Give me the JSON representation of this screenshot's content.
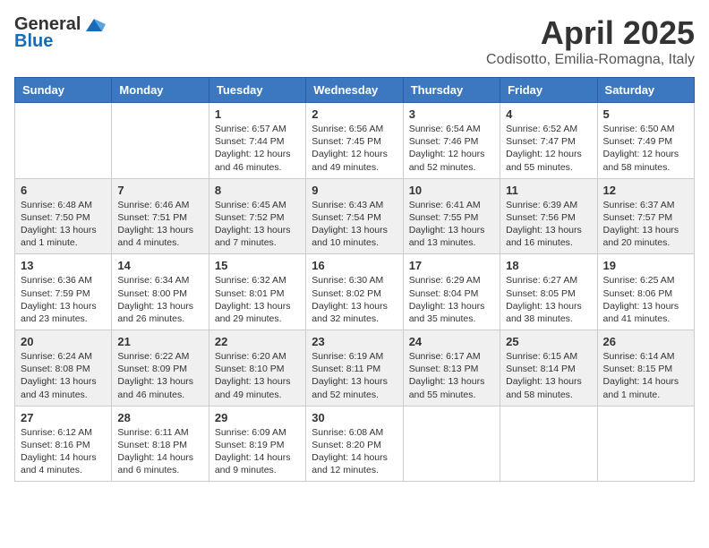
{
  "header": {
    "logo_general": "General",
    "logo_blue": "Blue",
    "month_title": "April 2025",
    "location": "Codisotto, Emilia-Romagna, Italy"
  },
  "weekdays": [
    "Sunday",
    "Monday",
    "Tuesday",
    "Wednesday",
    "Thursday",
    "Friday",
    "Saturday"
  ],
  "weeks": [
    [
      {
        "day": "",
        "info": ""
      },
      {
        "day": "",
        "info": ""
      },
      {
        "day": "1",
        "info": "Sunrise: 6:57 AM\nSunset: 7:44 PM\nDaylight: 12 hours\nand 46 minutes."
      },
      {
        "day": "2",
        "info": "Sunrise: 6:56 AM\nSunset: 7:45 PM\nDaylight: 12 hours\nand 49 minutes."
      },
      {
        "day": "3",
        "info": "Sunrise: 6:54 AM\nSunset: 7:46 PM\nDaylight: 12 hours\nand 52 minutes."
      },
      {
        "day": "4",
        "info": "Sunrise: 6:52 AM\nSunset: 7:47 PM\nDaylight: 12 hours\nand 55 minutes."
      },
      {
        "day": "5",
        "info": "Sunrise: 6:50 AM\nSunset: 7:49 PM\nDaylight: 12 hours\nand 58 minutes."
      }
    ],
    [
      {
        "day": "6",
        "info": "Sunrise: 6:48 AM\nSunset: 7:50 PM\nDaylight: 13 hours\nand 1 minute."
      },
      {
        "day": "7",
        "info": "Sunrise: 6:46 AM\nSunset: 7:51 PM\nDaylight: 13 hours\nand 4 minutes."
      },
      {
        "day": "8",
        "info": "Sunrise: 6:45 AM\nSunset: 7:52 PM\nDaylight: 13 hours\nand 7 minutes."
      },
      {
        "day": "9",
        "info": "Sunrise: 6:43 AM\nSunset: 7:54 PM\nDaylight: 13 hours\nand 10 minutes."
      },
      {
        "day": "10",
        "info": "Sunrise: 6:41 AM\nSunset: 7:55 PM\nDaylight: 13 hours\nand 13 minutes."
      },
      {
        "day": "11",
        "info": "Sunrise: 6:39 AM\nSunset: 7:56 PM\nDaylight: 13 hours\nand 16 minutes."
      },
      {
        "day": "12",
        "info": "Sunrise: 6:37 AM\nSunset: 7:57 PM\nDaylight: 13 hours\nand 20 minutes."
      }
    ],
    [
      {
        "day": "13",
        "info": "Sunrise: 6:36 AM\nSunset: 7:59 PM\nDaylight: 13 hours\nand 23 minutes."
      },
      {
        "day": "14",
        "info": "Sunrise: 6:34 AM\nSunset: 8:00 PM\nDaylight: 13 hours\nand 26 minutes."
      },
      {
        "day": "15",
        "info": "Sunrise: 6:32 AM\nSunset: 8:01 PM\nDaylight: 13 hours\nand 29 minutes."
      },
      {
        "day": "16",
        "info": "Sunrise: 6:30 AM\nSunset: 8:02 PM\nDaylight: 13 hours\nand 32 minutes."
      },
      {
        "day": "17",
        "info": "Sunrise: 6:29 AM\nSunset: 8:04 PM\nDaylight: 13 hours\nand 35 minutes."
      },
      {
        "day": "18",
        "info": "Sunrise: 6:27 AM\nSunset: 8:05 PM\nDaylight: 13 hours\nand 38 minutes."
      },
      {
        "day": "19",
        "info": "Sunrise: 6:25 AM\nSunset: 8:06 PM\nDaylight: 13 hours\nand 41 minutes."
      }
    ],
    [
      {
        "day": "20",
        "info": "Sunrise: 6:24 AM\nSunset: 8:08 PM\nDaylight: 13 hours\nand 43 minutes."
      },
      {
        "day": "21",
        "info": "Sunrise: 6:22 AM\nSunset: 8:09 PM\nDaylight: 13 hours\nand 46 minutes."
      },
      {
        "day": "22",
        "info": "Sunrise: 6:20 AM\nSunset: 8:10 PM\nDaylight: 13 hours\nand 49 minutes."
      },
      {
        "day": "23",
        "info": "Sunrise: 6:19 AM\nSunset: 8:11 PM\nDaylight: 13 hours\nand 52 minutes."
      },
      {
        "day": "24",
        "info": "Sunrise: 6:17 AM\nSunset: 8:13 PM\nDaylight: 13 hours\nand 55 minutes."
      },
      {
        "day": "25",
        "info": "Sunrise: 6:15 AM\nSunset: 8:14 PM\nDaylight: 13 hours\nand 58 minutes."
      },
      {
        "day": "26",
        "info": "Sunrise: 6:14 AM\nSunset: 8:15 PM\nDaylight: 14 hours\nand 1 minute."
      }
    ],
    [
      {
        "day": "27",
        "info": "Sunrise: 6:12 AM\nSunset: 8:16 PM\nDaylight: 14 hours\nand 4 minutes."
      },
      {
        "day": "28",
        "info": "Sunrise: 6:11 AM\nSunset: 8:18 PM\nDaylight: 14 hours\nand 6 minutes."
      },
      {
        "day": "29",
        "info": "Sunrise: 6:09 AM\nSunset: 8:19 PM\nDaylight: 14 hours\nand 9 minutes."
      },
      {
        "day": "30",
        "info": "Sunrise: 6:08 AM\nSunset: 8:20 PM\nDaylight: 14 hours\nand 12 minutes."
      },
      {
        "day": "",
        "info": ""
      },
      {
        "day": "",
        "info": ""
      },
      {
        "day": "",
        "info": ""
      }
    ]
  ]
}
